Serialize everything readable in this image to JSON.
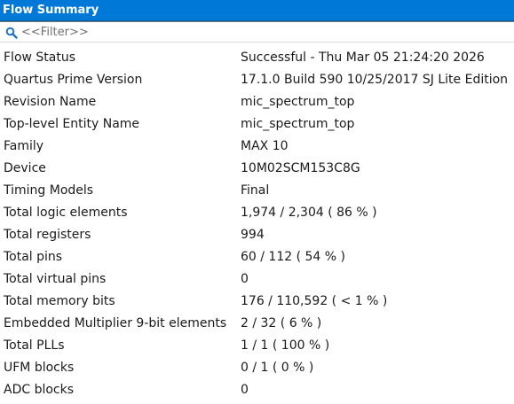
{
  "title": "Flow Summary",
  "filter": {
    "placeholder": "<<Filter>>",
    "icon": "search-icon"
  },
  "rows": [
    {
      "label": "Flow Status",
      "value": "Successful - Thu Mar 05 21:24:20 2026"
    },
    {
      "label": "Quartus Prime Version",
      "value": "17.1.0 Build 590 10/25/2017 SJ Lite Edition"
    },
    {
      "label": "Revision Name",
      "value": "mic_spectrum_top"
    },
    {
      "label": "Top-level Entity Name",
      "value": "mic_spectrum_top"
    },
    {
      "label": "Family",
      "value": "MAX 10"
    },
    {
      "label": "Device",
      "value": "10M02SCM153C8G"
    },
    {
      "label": "Timing Models",
      "value": "Final"
    },
    {
      "label": "Total logic elements",
      "value": "1,974 / 2,304 ( 86 % )"
    },
    {
      "label": "Total registers",
      "value": "994"
    },
    {
      "label": "Total pins",
      "value": "60 / 112 ( 54 % )"
    },
    {
      "label": "Total virtual pins",
      "value": "0"
    },
    {
      "label": "Total memory bits",
      "value": "176 / 110,592 ( < 1 % )"
    },
    {
      "label": "Embedded Multiplier 9-bit elements",
      "value": "2 / 32 ( 6 % )"
    },
    {
      "label": "Total PLLs",
      "value": "1 / 1 ( 100 % )"
    },
    {
      "label": "UFM blocks",
      "value": "0 / 1 ( 0 % )"
    },
    {
      "label": "ADC blocks",
      "value": "0"
    }
  ],
  "colors": {
    "title_bg": "#0078d7",
    "title_fg": "#ffffff",
    "text": "#1a1a1a",
    "filter_text": "#707070"
  }
}
